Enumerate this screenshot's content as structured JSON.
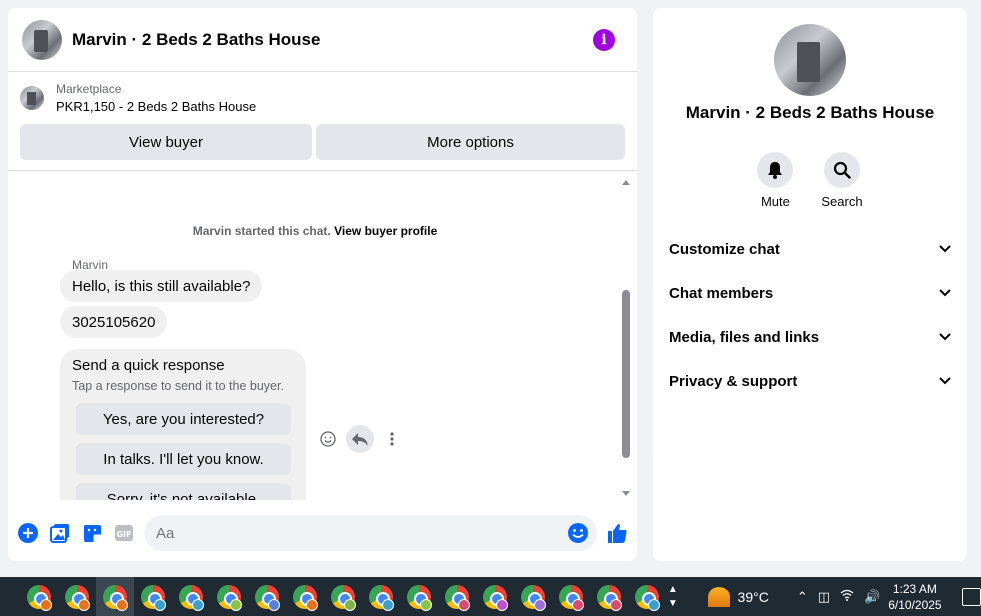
{
  "colors": {
    "accent": "#0866ff",
    "info": "#a200e0",
    "bubble": "#f0f0f0",
    "button": "#e4e6eb"
  },
  "chat": {
    "title": "Marvin · 2 Beds 2 Baths House",
    "marketplace_label": "Marketplace",
    "listing": "PKR1,150 - 2 Beds 2 Baths House",
    "view_buyer": "View buyer",
    "more_options": "More options",
    "started_text": "Marvin started this chat.",
    "view_buyer_profile": "View buyer profile",
    "sender": "Marvin",
    "messages": [
      "Hello, is this still available?",
      "3025105620"
    ],
    "quick_response": {
      "title": "Send a quick response",
      "subtitle": "Tap a response to send it to the buyer.",
      "options": [
        "Yes, are you interested?",
        "In talks. I'll let you know.",
        "Sorry, it's not available."
      ]
    },
    "composer_placeholder": "Aa"
  },
  "info": {
    "name": "Marvin · 2 Beds 2 Baths House",
    "mute": "Mute",
    "search": "Search",
    "sections": [
      "Customize chat",
      "Chat members",
      "Media, files and links",
      "Privacy & support"
    ]
  },
  "taskbar": {
    "temperature": "39°C",
    "time": "1:23 AM",
    "date": "6/10/2025",
    "apps": 17,
    "badge_colors": [
      "#e8711a",
      "#e8711a",
      "#e8711a",
      "#3aa0c8",
      "#3aa0c8",
      "#8bc34a",
      "#5a7fd6",
      "#e8711a",
      "#7cb342",
      "#3aa0c8",
      "#8bc34a",
      "#d84b6f",
      "#c04fd0",
      "#9c6fd6",
      "#d84b6f",
      "#d84b6f",
      "#3aa0c8"
    ]
  }
}
